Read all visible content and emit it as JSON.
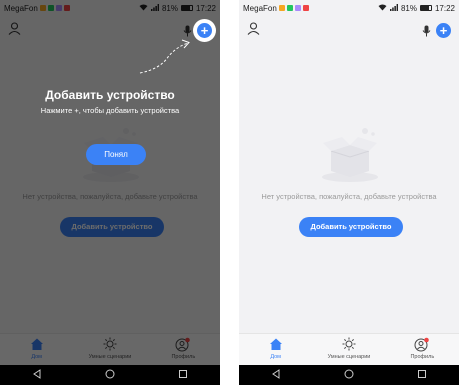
{
  "status_bar": {
    "carrier": "MegaFon",
    "battery": "81%",
    "time": "17:22",
    "notification_colors": [
      "#f5a623",
      "#22c55e",
      "#a78bfa",
      "#ef4444"
    ]
  },
  "header": {
    "profile_icon": "person-icon",
    "mic_icon": "microphone-icon",
    "add_icon": "plus-icon",
    "add_symbol": "+"
  },
  "empty_state": {
    "message": "Нет устройства, пожалуйста, добавьте устройства",
    "add_button": "Добавить устройство"
  },
  "onboarding": {
    "title": "Добавить устройство",
    "subtitle": "Нажмите +, чтобы добавить устройства",
    "ok_button": "Понял"
  },
  "tabs": [
    {
      "label": "Дом",
      "icon": "home-icon",
      "active": true
    },
    {
      "label": "Умные сценарии",
      "icon": "sun-icon",
      "active": false
    },
    {
      "label": "Профиль",
      "icon": "profile-icon",
      "active": false
    }
  ],
  "colors": {
    "accent": "#3b82f6",
    "badge": "#ef4444"
  }
}
